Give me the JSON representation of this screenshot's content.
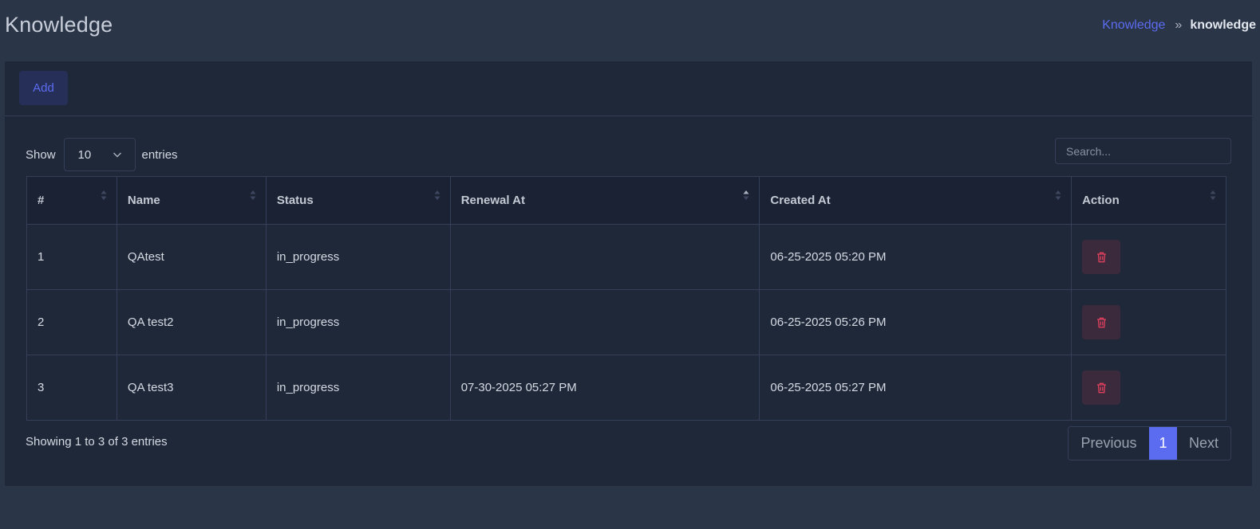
{
  "header": {
    "title": "Knowledge",
    "breadcrumb": {
      "link": "Knowledge",
      "separator": "»",
      "current": "knowledge"
    }
  },
  "toolbar": {
    "add_label": "Add"
  },
  "length": {
    "show_label": "Show",
    "value": "10",
    "entries_label": "entries"
  },
  "search": {
    "placeholder": "Search..."
  },
  "table": {
    "columns": [
      "#",
      "Name",
      "Status",
      "Renewal At",
      "Created At",
      "Action"
    ],
    "rows": [
      {
        "index": "1",
        "name": "QAtest",
        "status": "in_progress",
        "renewal_at": "",
        "created_at": "06-25-2025 05:20 PM"
      },
      {
        "index": "2",
        "name": "QA test2",
        "status": "in_progress",
        "renewal_at": "",
        "created_at": "06-25-2025 05:26 PM"
      },
      {
        "index": "3",
        "name": "QA test3",
        "status": "in_progress",
        "renewal_at": "07-30-2025 05:27 PM",
        "created_at": "06-25-2025 05:27 PM"
      }
    ]
  },
  "footer": {
    "info": "Showing 1 to 3 of 3 entries",
    "pagination": {
      "previous": "Previous",
      "current": "1",
      "next": "Next"
    }
  },
  "colors": {
    "accent": "#5b6cf0",
    "danger": "#e0405e",
    "background": "#2a3548",
    "card": "#1f2839"
  },
  "icons": {
    "sort": "sort-icon",
    "sort_asc": "sort-asc-icon",
    "select": "chevron-down-icon",
    "delete": "trash-icon"
  }
}
